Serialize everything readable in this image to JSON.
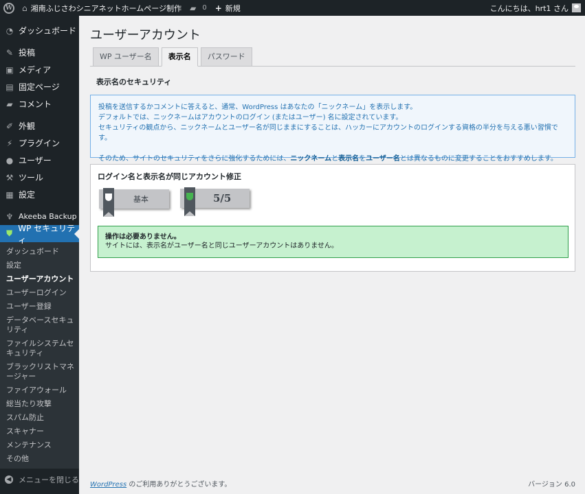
{
  "adminbar": {
    "site_name": "湘南ふじさわシニアネットホームページ制作",
    "comments_count": "0",
    "new_label": "新規",
    "greeting": "こんにちは、hrt1 さん"
  },
  "sidebar": {
    "items": [
      {
        "label": "ダッシュボード",
        "icon": "dashboard-icon"
      },
      {
        "label": "投稿",
        "icon": "pin-icon"
      },
      {
        "label": "メディア",
        "icon": "media-icon"
      },
      {
        "label": "固定ページ",
        "icon": "page-icon"
      },
      {
        "label": "コメント",
        "icon": "comment-icon"
      },
      {
        "label": "外観",
        "icon": "brush-icon"
      },
      {
        "label": "プラグイン",
        "icon": "plugin-icon"
      },
      {
        "label": "ユーザー",
        "icon": "user-icon"
      },
      {
        "label": "ツール",
        "icon": "wrench-icon"
      },
      {
        "label": "設定",
        "icon": "settings-icon"
      },
      {
        "label": "Akeeba Backup",
        "icon": "akeeba-icon"
      },
      {
        "label": "WP セキュリティ",
        "icon": "shield-icon"
      }
    ],
    "submenu": [
      "ダッシュボード",
      "設定",
      "ユーザーアカウント",
      "ユーザーログイン",
      "ユーザー登録",
      "データベースセキュリティ",
      "ファイルシステムセキュリティ",
      "ブラックリストマネージャー",
      "ファイアウォール",
      "総当たり攻撃",
      "スパム防止",
      "スキャナー",
      "メンテナンス",
      "その他"
    ],
    "collapse_label": "メニューを閉じる"
  },
  "main": {
    "title": "ユーザーアカウント",
    "tabs": [
      "WP ユーザー名",
      "表示名",
      "パスワード"
    ],
    "section_title": "表示名のセキュリティ",
    "info_lines": [
      "投稿を送信するかコメントに答えると、通常、WordPress はあなたの「ニックネーム」を表示します。",
      "デフォルトでは、ニックネームはアカウントのログイン (またはユーザー) 名に設定されています。",
      "セキュリティの観点から、ニックネームとユーザー名が同じままにすることは、ハッカーにアカウントのログインする資格の半分を与える悪い習慣です。"
    ],
    "info_recommend": {
      "prefix": "そのため、サイトのセキュリティをさらに強化するためには、",
      "nickname": "ニックネーム",
      "and": "と",
      "display_name": "表示名",
      "wo": "を",
      "username": "ユーザー名",
      "suffix": "とは異なるものに変更することをおすすめします。"
    },
    "postbox_title": "ログイン名と表示名が同じアカウント修正",
    "badge_level": "基本",
    "badge_score": "5/5",
    "success_title": "操作は必要ありません。",
    "success_text": "サイトには、表示名がユーザー名と同じユーザーアカウントはありません。"
  },
  "footer": {
    "link": "WordPress",
    "thanks": " のご利用ありがとうございます。",
    "version": "バージョン 6.0"
  }
}
